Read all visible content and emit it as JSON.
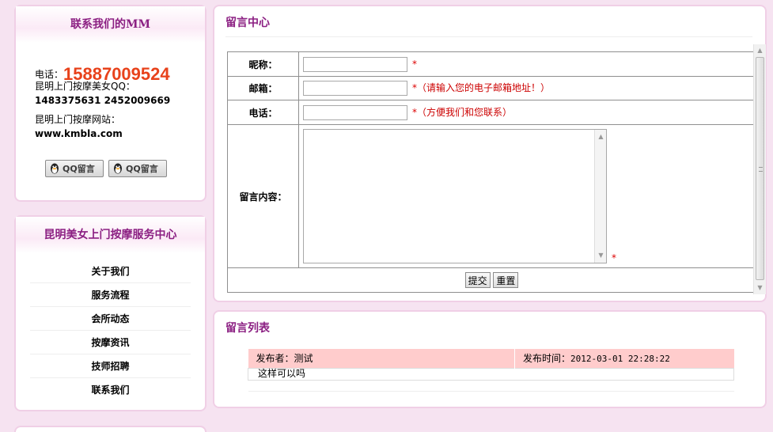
{
  "contact": {
    "title": "联系我们的MM",
    "phone_label": "电话：",
    "phone_number": "15887009524",
    "qq_label": "昆明上门按摩美女QQ：",
    "qq_numbers": "1483375631  2452009669",
    "site_label": "昆明上门按摩网站：",
    "site_url": "www.kmbla.com",
    "qq_buttons": [
      "QQ留言",
      "QQ留言"
    ]
  },
  "nav": {
    "title": "昆明美女上门按摩服务中心",
    "items": [
      "关于我们",
      "服务流程",
      "会所动态",
      "按摩资讯",
      "技师招聘",
      "联系我们"
    ]
  },
  "guestbook": {
    "title": "留言中心",
    "nickname_label": "昵称：",
    "nickname_value": "",
    "email_label": "邮箱：",
    "email_value": "",
    "email_hint": "（请输入您的电子邮箱地址！）",
    "phone_label": "电话：",
    "phone_value": "",
    "phone_hint": "（方便我们和您联系）",
    "message_label": "留言内容：",
    "message_value": "",
    "required_mark": "*",
    "submit_label": "提交",
    "reset_label": "重置"
  },
  "message_list": {
    "title": "留言列表",
    "entries": [
      {
        "poster_label": "发布者：",
        "poster": "测试",
        "time_label": "发布时间：",
        "time": "2012-03-01 22:28:22",
        "content": "这样可以吗"
      }
    ]
  },
  "colors": {
    "accent": "#8b1f82",
    "phone": "#e8421b",
    "background": "#f6e3f1",
    "list_header": "#ffcccc",
    "required": "#dd0000"
  },
  "icons": {
    "qq_button": "qq-penguin-icon"
  }
}
